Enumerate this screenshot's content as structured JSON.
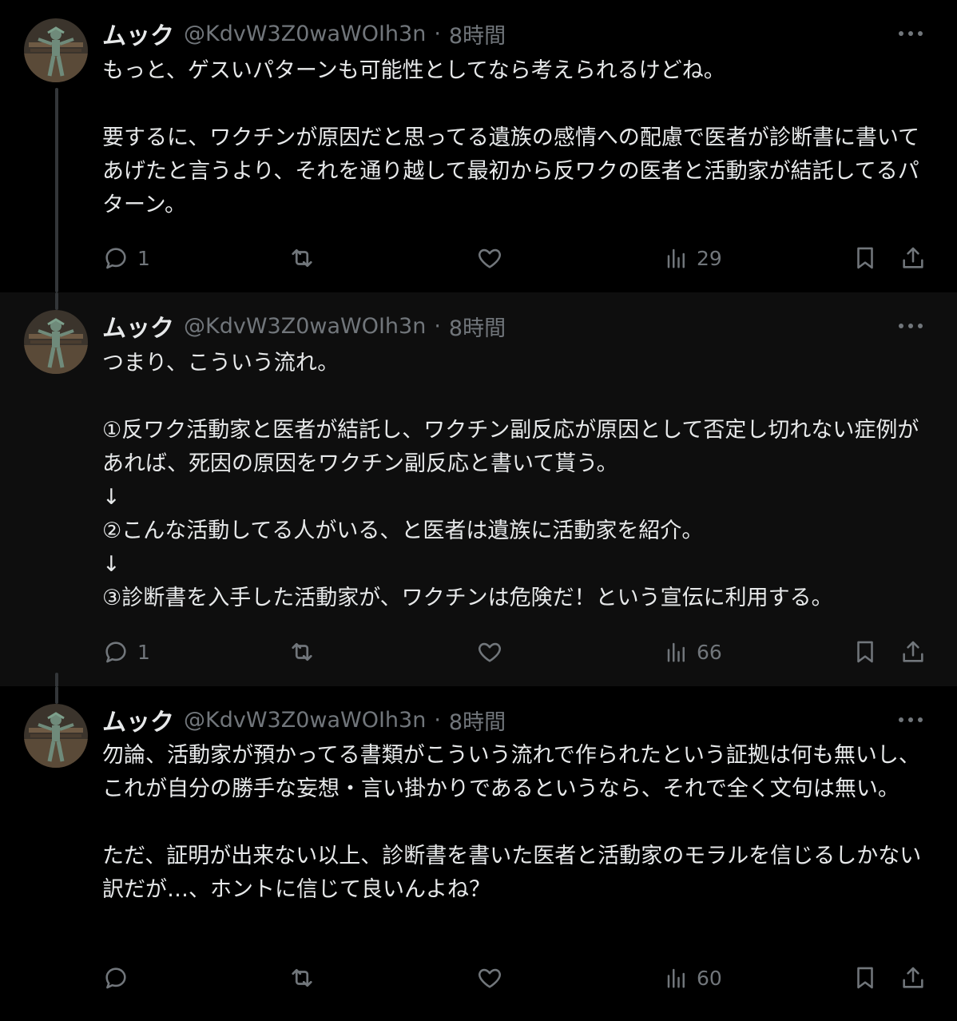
{
  "tweets": [
    {
      "name": "ムック",
      "handle": "@KdvW3Z0waWOIh3n",
      "dot": "·",
      "time": "8時間",
      "text": "もっと、ゲスいパターンも可能性としてなら考えられるけどね。\n\n要するに、ワクチンが原因だと思ってる遺族の感情への配慮で医者が診断書に書いてあげたと言うより、それを通り越して最初から反ワクの医者と活動家が結託してるパターン。",
      "replies": "1",
      "retweets": "",
      "likes": "",
      "views": "29"
    },
    {
      "name": "ムック",
      "handle": "@KdvW3Z0waWOIh3n",
      "dot": "·",
      "time": "8時間",
      "text": "つまり、こういう流れ。\n\n①反ワク活動家と医者が結託し、ワクチン副反応が原因として否定し切れない症例があれば、死因の原因をワクチン副反応と書いて貰う。\n↓\n②こんな活動してる人がいる、と医者は遺族に活動家を紹介。\n↓\n③診断書を入手した活動家が、ワクチンは危険だ！という宣伝に利用する。",
      "replies": "1",
      "retweets": "",
      "likes": "",
      "views": "66"
    },
    {
      "name": "ムック",
      "handle": "@KdvW3Z0waWOIh3n",
      "dot": "·",
      "time": "8時間",
      "text": "勿論、活動家が預かってる書類がこういう流れで作られたという証拠は何も無いし、これが自分の勝手な妄想・言い掛かりであるというなら、それで全く文句は無い。\n\nただ、証明が出来ない以上、診断書を書いた医者と活動家のモラルを信じるしかない訳だが…、ホントに信じて良いんよね？",
      "replies": "",
      "retweets": "",
      "likes": "",
      "views": "60"
    }
  ],
  "icons": {
    "more": "more-horizontal-icon",
    "reply": "reply-icon",
    "retweet": "retweet-icon",
    "like": "heart-icon",
    "views": "views-icon",
    "bookmark": "bookmark-icon",
    "share": "share-icon"
  },
  "colors": {
    "background": "#000000",
    "highlighted_background": "#0e0e0e",
    "text": "#e7e9ea",
    "muted": "#71767b",
    "thread_line": "#333639"
  }
}
